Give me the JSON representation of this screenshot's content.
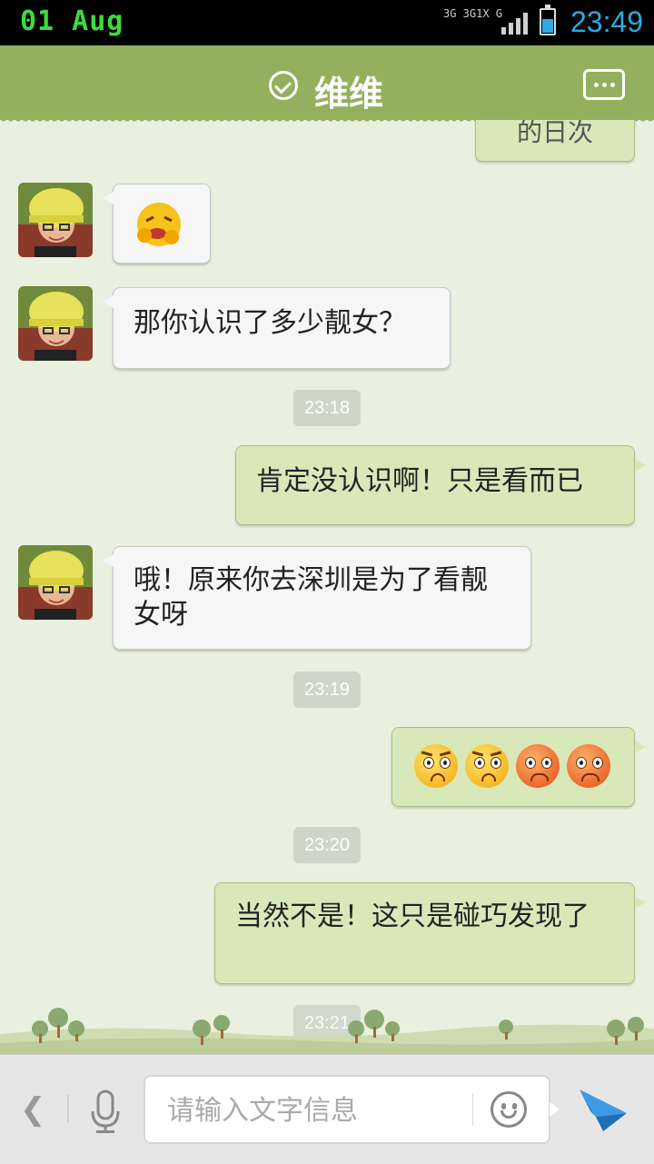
{
  "status_bar": {
    "date": "01 Aug",
    "network_top": "3G 3G1X G",
    "time": "23:49"
  },
  "header": {
    "contact_name": "维维"
  },
  "messages": [
    {
      "dir": "out",
      "text": "的日次",
      "partial": true
    },
    {
      "dir": "in",
      "type": "emoji",
      "icon": "laughing-emoji-icon"
    },
    {
      "dir": "in",
      "text": "那你认识了多少靓女？"
    },
    {
      "type": "time",
      "text": "23:18"
    },
    {
      "dir": "out",
      "text": "肯定没认识啊！只是看而已"
    },
    {
      "dir": "in",
      "text": "哦！原来你去深圳是为了看靓女呀"
    },
    {
      "type": "time",
      "text": "23:19"
    },
    {
      "dir": "out",
      "type": "emoji",
      "icons": [
        "glaring-emoji-icon",
        "glaring-emoji-icon",
        "angry-red-emoji-icon",
        "angry-red-emoji-icon"
      ]
    },
    {
      "type": "time",
      "text": "23:20"
    },
    {
      "dir": "out",
      "text": "当然不是！这只是碰巧发现了"
    },
    {
      "type": "time",
      "text": "23:21"
    }
  ],
  "input": {
    "placeholder": "请输入文字信息",
    "value": ""
  },
  "colors": {
    "header_green": "#93b05e",
    "bubble_out": "#d9e8b8",
    "bubble_in": "#f6f6f6",
    "background": "#e9f0df",
    "send_blue": "#2a8ad8"
  }
}
